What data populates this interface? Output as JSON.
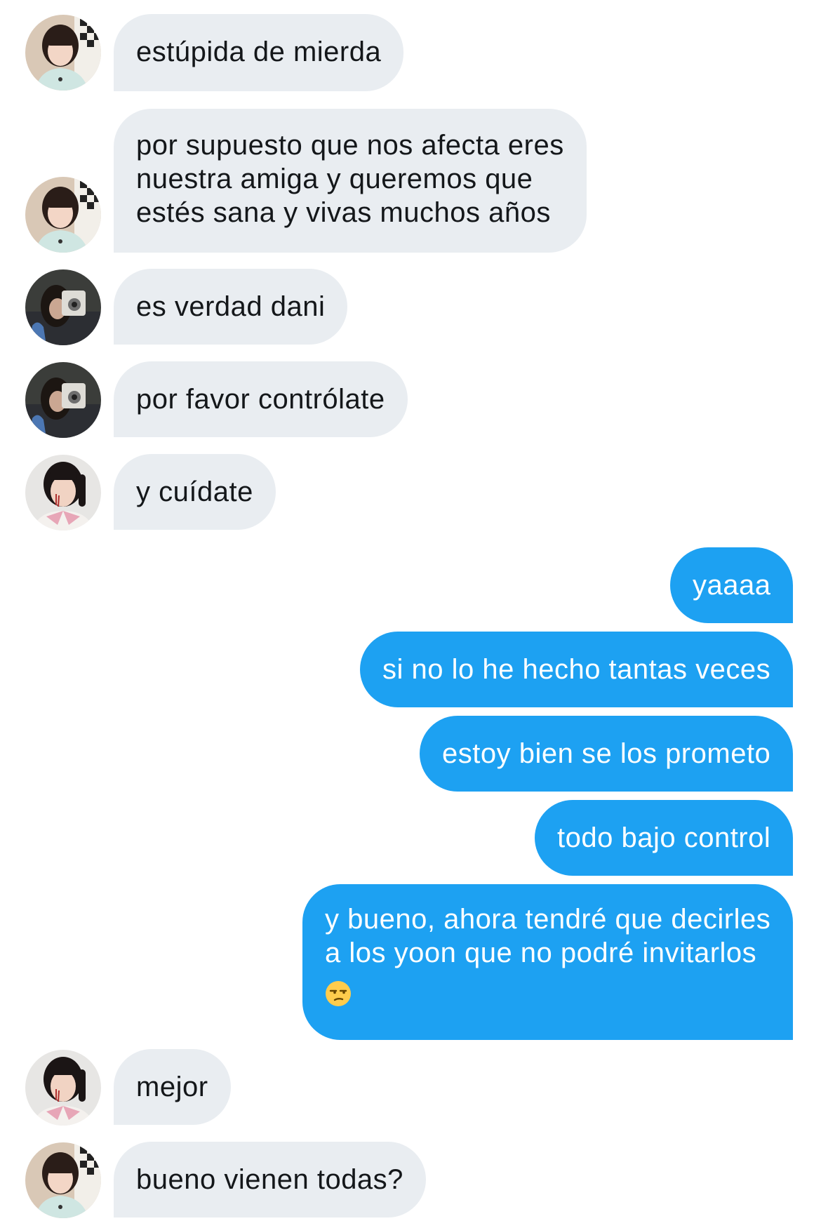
{
  "messages": [
    {
      "sender": "friend_a",
      "avatar_icon": "avatar-a-icon",
      "text": "estúpida de mierda"
    },
    {
      "sender": "friend_a",
      "avatar_icon": "avatar-a-icon",
      "lines": [
        "por supuesto que nos afecta eres",
        "nuestra amiga y queremos que",
        "estés sana y vivas muchos años"
      ]
    },
    {
      "sender": "friend_b",
      "avatar_icon": "avatar-b-icon",
      "text": "es verdad dani"
    },
    {
      "sender": "friend_b",
      "avatar_icon": "avatar-b-icon",
      "text": "por favor contrólate"
    },
    {
      "sender": "friend_c",
      "avatar_icon": "avatar-c-icon",
      "text": "y cuídate"
    },
    {
      "sender": "me",
      "text": "yaaaa"
    },
    {
      "sender": "me",
      "text": "si no lo he hecho tantas veces"
    },
    {
      "sender": "me",
      "text": "estoy bien se los prometo"
    },
    {
      "sender": "me",
      "text": "todo bajo control"
    },
    {
      "sender": "me",
      "lines": [
        "y bueno, ahora tendré que decirles",
        "a los yoon que no podré invitarlos"
      ],
      "emoji": "unamused-face-icon"
    },
    {
      "sender": "friend_c",
      "avatar_icon": "avatar-c-icon",
      "text": "mejor"
    },
    {
      "sender": "friend_a",
      "avatar_icon": "avatar-a-icon",
      "text": "bueno vienen todas?"
    }
  ],
  "colors": {
    "incoming_bubble": "#e9edf1",
    "incoming_text": "#14171a",
    "outgoing_bubble": "#1da1f2",
    "outgoing_text": "#ffffff"
  }
}
